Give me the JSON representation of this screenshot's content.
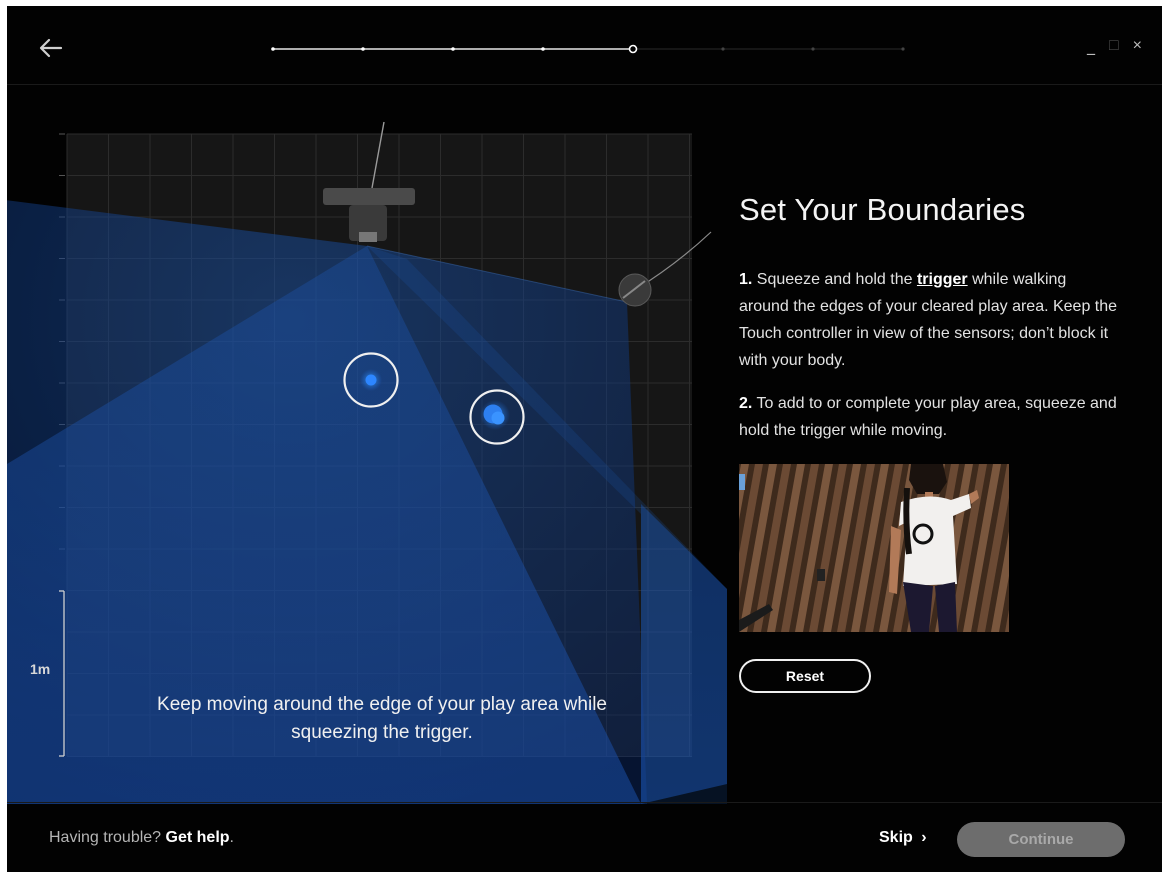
{
  "title": "Set Your Boundaries",
  "steps": [
    {
      "number": "1.",
      "text_before": "Squeeze and hold the",
      "link": "trigger",
      "text_after": "while walking around the edges of your cleared play area. Keep the Touch controller in view of the sensors; don’t block it with your body."
    },
    {
      "number": "2.",
      "text": "To add to or complete your play area, squeeze and hold the trigger while moving."
    }
  ],
  "visualization": {
    "scale_label": "1m",
    "caption": "Keep moving around the edge of your play area while squeezing the trigger."
  },
  "buttons": {
    "reset": "Reset",
    "skip": "Skip",
    "skip_chevron": "›",
    "continue": "Continue"
  },
  "footer": {
    "help_prefix": "Having trouble?",
    "help_link": "Get help",
    "help_suffix": "."
  },
  "window_controls": {
    "minimize": "_",
    "maximize": "□",
    "close": "×"
  },
  "progress": {
    "total_steps": 8,
    "current_step": 5
  },
  "colors": {
    "accent_blue": "#1f6ee0",
    "background": "#020202",
    "continue_disabled": "#6d6d6d"
  },
  "icons": {
    "back": "back-arrow-icon",
    "controller_left": "controller-marker-icon",
    "controller_right": "controller-marker-icon",
    "sensor_top": "sensor-icon",
    "sensor_right": "sensor-icon"
  }
}
